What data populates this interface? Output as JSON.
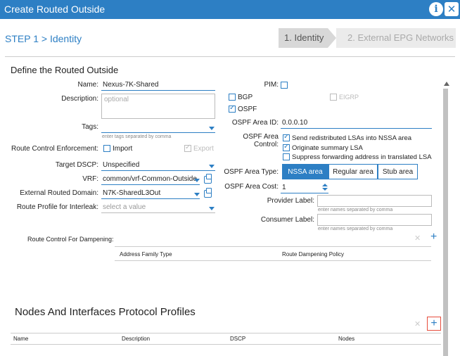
{
  "window": {
    "title": "Create Routed Outside"
  },
  "steps": {
    "header": "STEP 1 > Identity",
    "step1": "1. Identity",
    "step2": "2. External EPG Networks"
  },
  "section": {
    "title": "Define the Routed Outside"
  },
  "left": {
    "name_label": "Name:",
    "name_value": "Nexus-7K-Shared",
    "description_label": "Description:",
    "description_placeholder": "optional",
    "tags_label": "Tags:",
    "tags_hint": "enter tags separated by comma",
    "rce_label": "Route Control Enforcement:",
    "import_label": "Import",
    "export_label": "Export",
    "dscp_label": "Target DSCP:",
    "dscp_value": "Unspecified",
    "vrf_label": "VRF:",
    "vrf_value": "common/vrf-Common-Outside",
    "domain_label": "External Routed Domain:",
    "domain_value": "N7K-SharedL3Out",
    "route_profile_label": "Route Profile for Interleak:",
    "route_profile_placeholder": "select a value"
  },
  "right": {
    "pim_label": "PIM:",
    "bgp_label": "BGP",
    "eigrp_label": "EIGRP",
    "ospf_label": "OSPF",
    "area_id_label": "OSPF Area ID:",
    "area_id_value": "0.0.0.10",
    "area_control_label1": "OSPF Area",
    "area_control_label2": "Control:",
    "area_control_opts": [
      "Send redistributed LSAs into NSSA area",
      "Originate summary LSA",
      "Suppress forwarding address in translated LSA"
    ],
    "area_type_label": "OSPF Area Type:",
    "area_types": [
      "NSSA area",
      "Regular area",
      "Stub area"
    ],
    "area_cost_label": "OSPF Area Cost:",
    "area_cost_value": "1",
    "provider_label": "Provider Label:",
    "provider_hint": "enter names separated by comma",
    "consumer_label": "Consumer Label:",
    "consumer_hint": "enter names separated by comma"
  },
  "dampening": {
    "label": "Route Control For Dampening:",
    "col1": "Address Family Type",
    "col2": "Route Dampening Policy"
  },
  "nodes": {
    "title": "Nodes And Interfaces Protocol Profiles",
    "columns": [
      "Name",
      "Description",
      "DSCP",
      "Nodes"
    ]
  },
  "icons": {
    "x": "✕",
    "plus": "+",
    "info": "i",
    "close": "✕"
  }
}
